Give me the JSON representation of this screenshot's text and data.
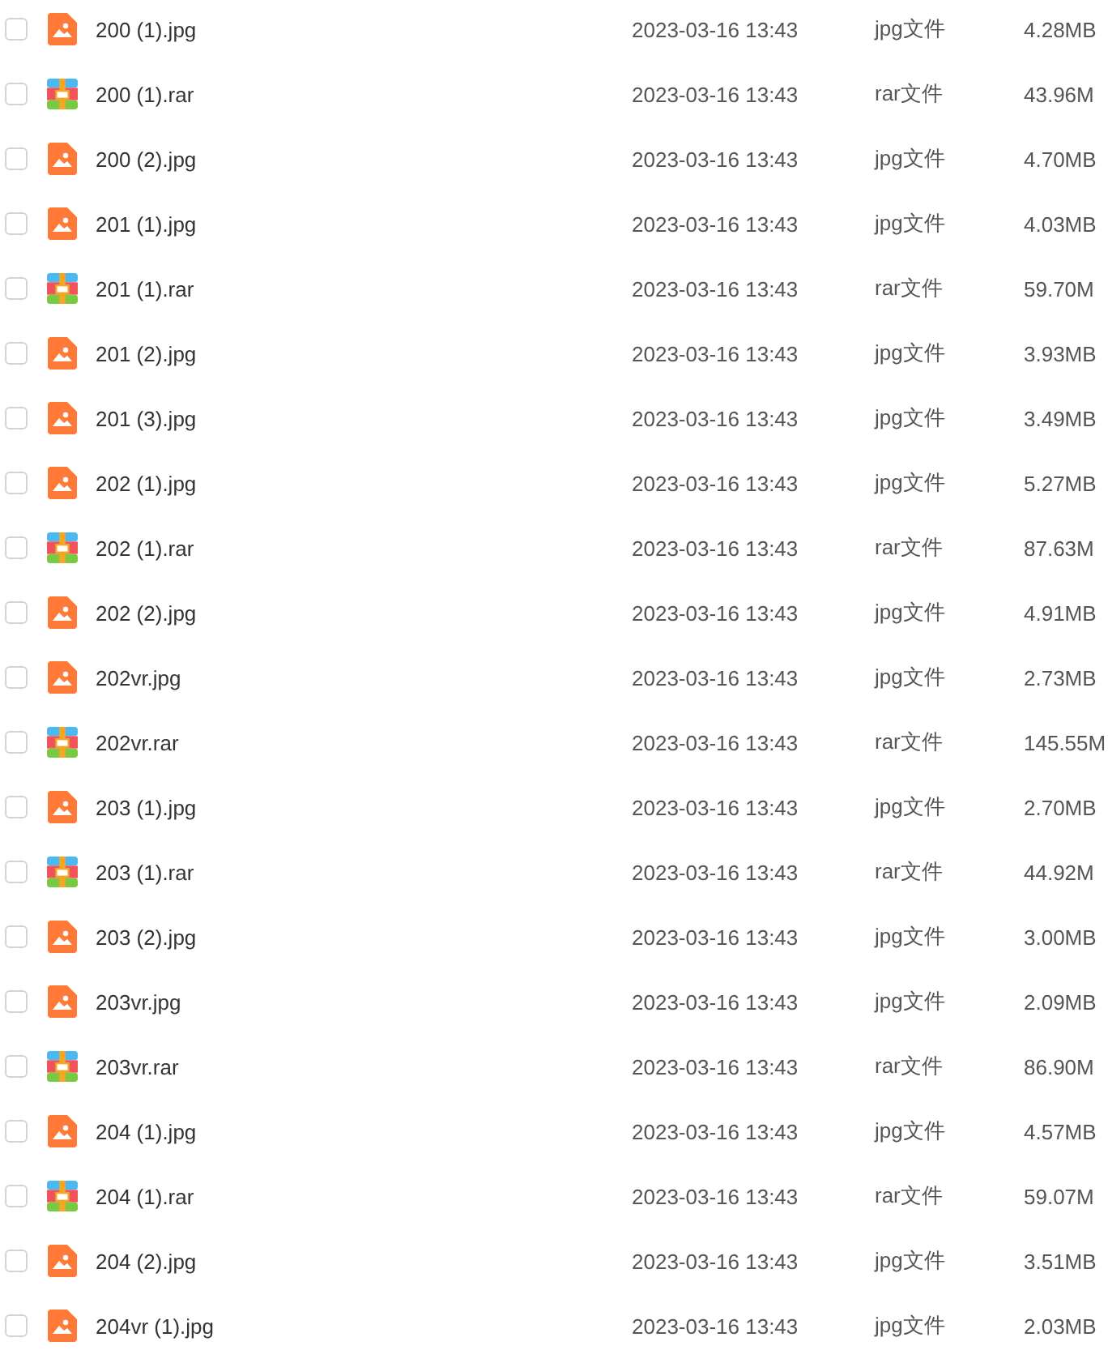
{
  "files": [
    {
      "kind": "jpg",
      "name": "200 (1).jpg",
      "date": "2023-03-16 13:43",
      "type": "jpg文件",
      "size": "4.28MB",
      "checked": false
    },
    {
      "kind": "rar",
      "name": "200 (1).rar",
      "date": "2023-03-16 13:43",
      "type": "rar文件",
      "size": "43.96M",
      "checked": false
    },
    {
      "kind": "jpg",
      "name": "200 (2).jpg",
      "date": "2023-03-16 13:43",
      "type": "jpg文件",
      "size": "4.70MB",
      "checked": false
    },
    {
      "kind": "jpg",
      "name": "201 (1).jpg",
      "date": "2023-03-16 13:43",
      "type": "jpg文件",
      "size": "4.03MB",
      "checked": false
    },
    {
      "kind": "rar",
      "name": "201 (1).rar",
      "date": "2023-03-16 13:43",
      "type": "rar文件",
      "size": "59.70M",
      "checked": false
    },
    {
      "kind": "jpg",
      "name": "201 (2).jpg",
      "date": "2023-03-16 13:43",
      "type": "jpg文件",
      "size": "3.93MB",
      "checked": false
    },
    {
      "kind": "jpg",
      "name": "201 (3).jpg",
      "date": "2023-03-16 13:43",
      "type": "jpg文件",
      "size": "3.49MB",
      "checked": false
    },
    {
      "kind": "jpg",
      "name": "202 (1).jpg",
      "date": "2023-03-16 13:43",
      "type": "jpg文件",
      "size": "5.27MB",
      "checked": false
    },
    {
      "kind": "rar",
      "name": "202 (1).rar",
      "date": "2023-03-16 13:43",
      "type": "rar文件",
      "size": "87.63M",
      "checked": false
    },
    {
      "kind": "jpg",
      "name": "202 (2).jpg",
      "date": "2023-03-16 13:43",
      "type": "jpg文件",
      "size": "4.91MB",
      "checked": false
    },
    {
      "kind": "jpg",
      "name": "202vr.jpg",
      "date": "2023-03-16 13:43",
      "type": "jpg文件",
      "size": "2.73MB",
      "checked": false
    },
    {
      "kind": "rar",
      "name": "202vr.rar",
      "date": "2023-03-16 13:43",
      "type": "rar文件",
      "size": "145.55M",
      "checked": false
    },
    {
      "kind": "jpg",
      "name": "203 (1).jpg",
      "date": "2023-03-16 13:43",
      "type": "jpg文件",
      "size": "2.70MB",
      "checked": false
    },
    {
      "kind": "rar",
      "name": "203 (1).rar",
      "date": "2023-03-16 13:43",
      "type": "rar文件",
      "size": "44.92M",
      "checked": false
    },
    {
      "kind": "jpg",
      "name": "203 (2).jpg",
      "date": "2023-03-16 13:43",
      "type": "jpg文件",
      "size": "3.00MB",
      "checked": false
    },
    {
      "kind": "jpg",
      "name": "203vr.jpg",
      "date": "2023-03-16 13:43",
      "type": "jpg文件",
      "size": "2.09MB",
      "checked": false
    },
    {
      "kind": "rar",
      "name": "203vr.rar",
      "date": "2023-03-16 13:43",
      "type": "rar文件",
      "size": "86.90M",
      "checked": false
    },
    {
      "kind": "jpg",
      "name": "204 (1).jpg",
      "date": "2023-03-16 13:43",
      "type": "jpg文件",
      "size": "4.57MB",
      "checked": false
    },
    {
      "kind": "rar",
      "name": "204 (1).rar",
      "date": "2023-03-16 13:43",
      "type": "rar文件",
      "size": "59.07M",
      "checked": false
    },
    {
      "kind": "jpg",
      "name": "204 (2).jpg",
      "date": "2023-03-16 13:43",
      "type": "jpg文件",
      "size": "3.51MB",
      "checked": false
    },
    {
      "kind": "jpg",
      "name": "204vr (1).jpg",
      "date": "2023-03-16 13:43",
      "type": "jpg文件",
      "size": "2.03MB",
      "checked": false
    }
  ]
}
